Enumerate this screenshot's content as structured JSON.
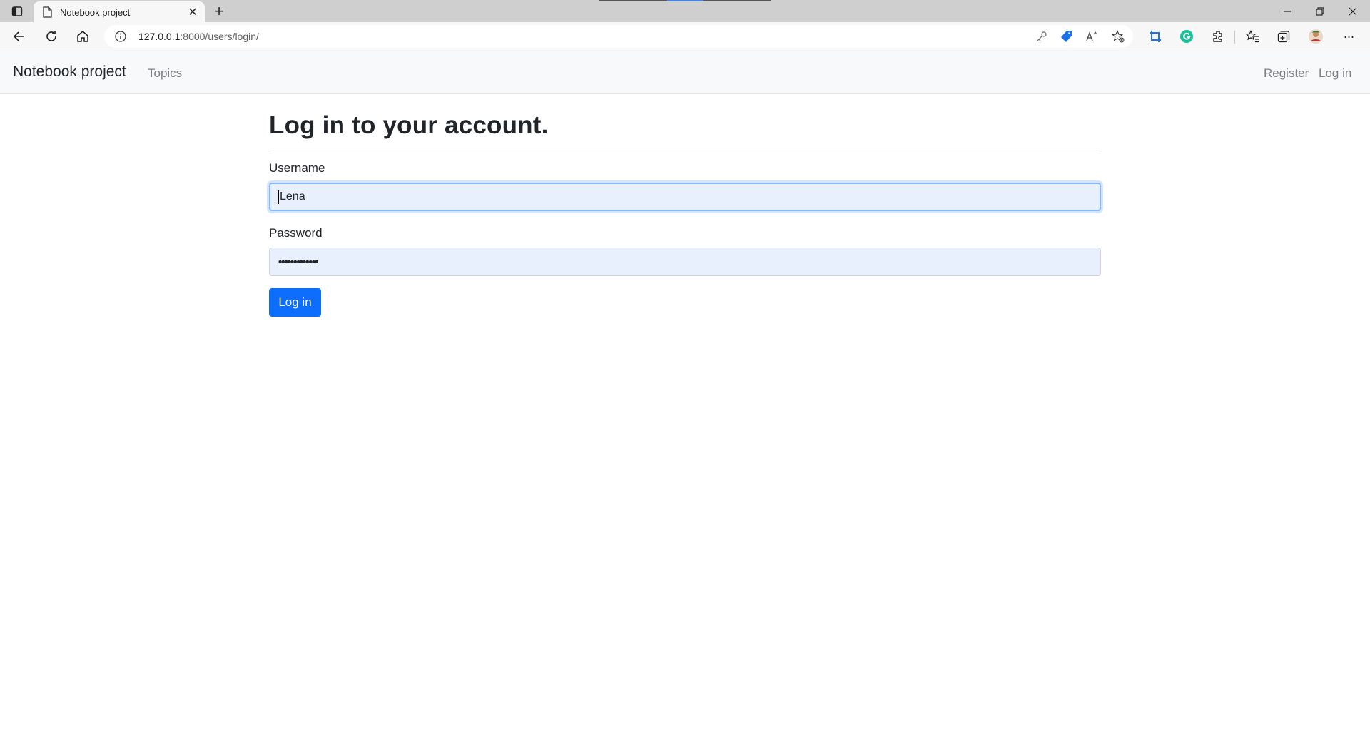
{
  "browser": {
    "tab_title": "Notebook project",
    "new_tab_symbol": "+",
    "tab_close_symbol": "✕",
    "url_host": "127.0.0.1",
    "url_path": ":8000/users/login/",
    "more_symbol": "···"
  },
  "navbar": {
    "brand": "Notebook project",
    "links": {
      "topics": "Topics",
      "register": "Register",
      "login": "Log in"
    }
  },
  "form": {
    "heading": "Log in to your account.",
    "username_label": "Username",
    "username_value": "Lena",
    "password_label": "Password",
    "password_value": "•••••••••••••",
    "submit_label": "Log in"
  },
  "colors": {
    "accent": "#0d6efd",
    "autofill_bg": "#e8f0fe",
    "navbar_bg": "#f8f9fa"
  }
}
